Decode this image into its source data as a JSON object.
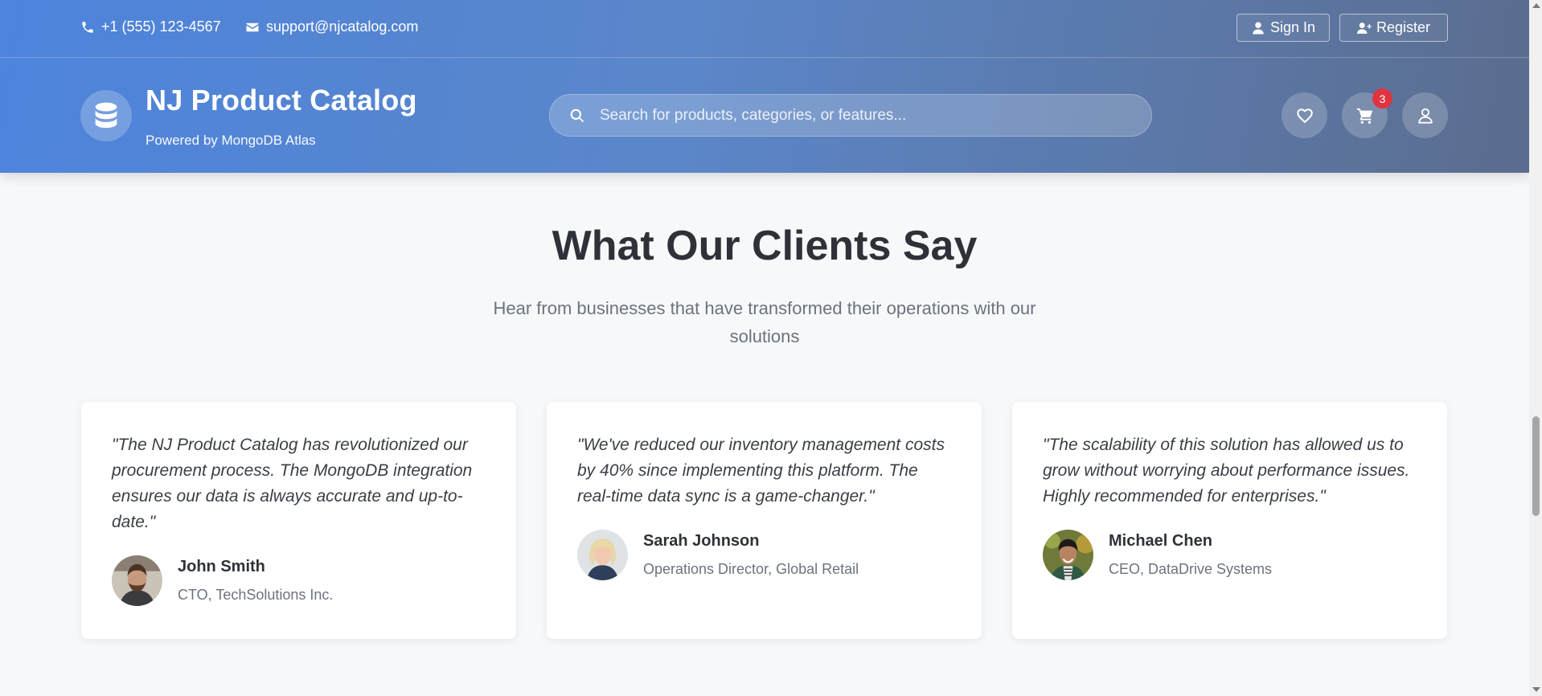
{
  "topbar": {
    "phone": "+1 (555) 123-4567",
    "email": "support@njcatalog.com",
    "sign_in_label": "Sign In",
    "register_label": "Register"
  },
  "brand": {
    "title": "NJ Product Catalog",
    "subtitle": "Powered by MongoDB Atlas",
    "logo_icon": "database-icon"
  },
  "search": {
    "placeholder": "Search for products, categories, or features..."
  },
  "header_actions": {
    "wishlist_icon": "heart-icon",
    "cart_icon": "cart-icon",
    "cart_count": "3",
    "account_icon": "user-icon"
  },
  "testimonials": {
    "title": "What Our Clients Say",
    "subtitle": "Hear from businesses that have transformed their operations with our solutions",
    "items": [
      {
        "quote": "\"The NJ Product Catalog has revolutionized our procurement process. The MongoDB integration ensures our data is always accurate and up-to-date.\"",
        "name": "John Smith",
        "role": "CTO, TechSolutions Inc."
      },
      {
        "quote": "\"We've reduced our inventory management costs by 40% since implementing this platform. The real-time data sync is a game-changer.\"",
        "name": "Sarah Johnson",
        "role": "Operations Director, Global Retail"
      },
      {
        "quote": "\"The scalability of this solution has allowed us to grow without worrying about performance issues. Highly recommended for enterprises.\"",
        "name": "Michael Chen",
        "role": "CEO, DataDrive Systems"
      }
    ]
  },
  "colors": {
    "header_start": "#4d84dc",
    "header_end": "#5b6d8e",
    "badge": "#e03340",
    "page_bg": "#f7f8fa"
  }
}
